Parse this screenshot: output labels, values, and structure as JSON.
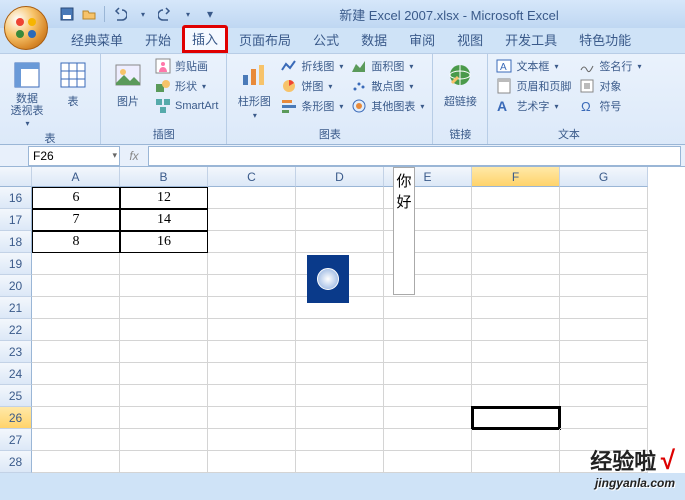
{
  "window": {
    "title": "新建 Excel 2007.xlsx - Microsoft Excel"
  },
  "qat": {
    "save": "save-icon",
    "undo": "undo-icon",
    "redo": "redo-icon",
    "open": "open-icon",
    "print": "print-icon"
  },
  "tabs": {
    "classic": "经典菜单",
    "home": "开始",
    "insert": "插入",
    "layout": "页面布局",
    "formula": "公式",
    "data": "数据",
    "review": "审阅",
    "view": "视图",
    "dev": "开发工具",
    "special": "特色功能"
  },
  "ribbon": {
    "groups": {
      "tables": {
        "label": "表",
        "pivot": "数据\n透视表",
        "table": "表"
      },
      "illustrations": {
        "label": "插图",
        "picture": "图片",
        "clipart": "剪贴画",
        "shapes": "形状",
        "smartart": "SmartArt"
      },
      "charts": {
        "label": "图表",
        "column": "柱形图",
        "line": "折线图",
        "pie": "饼图",
        "bar": "条形图",
        "area": "面积图",
        "scatter": "散点图",
        "other": "其他图表"
      },
      "links": {
        "label": "链接",
        "hyperlink": "超链接"
      },
      "text": {
        "label": "文本",
        "textbox": "文本框",
        "headerfooter": "页眉和页脚",
        "wordart": "艺术字",
        "sigline": "签名行",
        "object": "对象",
        "symbol": "符号"
      }
    }
  },
  "namebox": {
    "value": "F26"
  },
  "sheet": {
    "col_headers": [
      "A",
      "B",
      "C",
      "D",
      "E",
      "F",
      "G"
    ],
    "row_numbers": [
      "16",
      "17",
      "18",
      "19",
      "20",
      "21",
      "22",
      "23",
      "24",
      "25",
      "26",
      "27",
      "28"
    ],
    "data": {
      "r16": {
        "A": "6",
        "B": "12"
      },
      "r17": {
        "A": "7",
        "B": "14"
      },
      "r18": {
        "A": "8",
        "B": "16"
      }
    },
    "textbox": {
      "line1": "你",
      "line2": "好"
    },
    "active_cell": "F26"
  },
  "watermark": {
    "line1": "经验啦",
    "check": "√",
    "line2": "jingyanla.com"
  }
}
